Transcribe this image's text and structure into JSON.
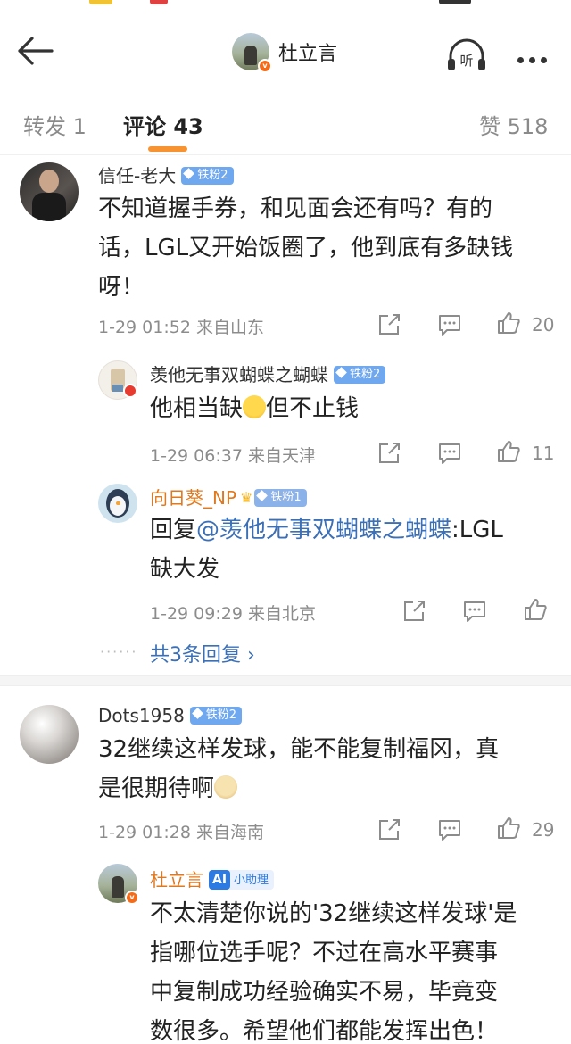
{
  "header": {
    "back_icon": "arrow-left-icon",
    "title_name": "杜立言",
    "listen_label": "听",
    "more_icon": "ellipsis-icon"
  },
  "tabs": {
    "repost": "转发 1",
    "comments": "评论 43",
    "likes": "赞 518",
    "active_color": "#f79330"
  },
  "comments": [
    {
      "user": "信任-老大",
      "badge": "铁粉2",
      "text_lines": [
        "不知道握手券，和见面会还有吗？有的",
        "话，LGL又开始饭圈了，他到底有多缺钱",
        "呀！"
      ],
      "meta": "1-29 01:52  来自山东",
      "likes": "20",
      "replies": [
        {
          "user": "羡他无事双蝴蝶之蝴蝶",
          "badge": "铁粉2",
          "text_before": "他相当缺",
          "text_after": "但不止钱",
          "meta": "1-29 06:37  来自天津",
          "likes": "11"
        },
        {
          "user": "向日葵_NP",
          "badge": "铁粉1",
          "reply_prefix": "回复",
          "mention": "@羡他无事双蝴蝶之蝴蝶",
          "text_line1_after": ":LGL",
          "text_line2": "缺大发",
          "meta": "1-29 09:29  来自北京"
        }
      ],
      "more_replies": "共3条回复 ›"
    },
    {
      "user": "Dots1958",
      "badge": "铁粉2",
      "text_lines": [
        "32继续这样发球，能不能复制福冈，真",
        "是很期待啊"
      ],
      "meta": "1-29 01:28  来自海南",
      "likes": "29",
      "replies": [
        {
          "user": "杜立言",
          "ai_badge_mark": "AI",
          "ai_badge_label": "小助理",
          "text_lines": [
            "不太清楚你说的'32继续这样发球'是",
            "指哪位选手呢？不过在高水平赛事",
            "中复制成功经验确实不易，毕竟变",
            "数很多。希望他们都能发挥出色！"
          ]
        }
      ]
    }
  ],
  "icons": {
    "share": "share-icon",
    "comment": "comment-icon",
    "like": "thumbs-up-icon"
  }
}
